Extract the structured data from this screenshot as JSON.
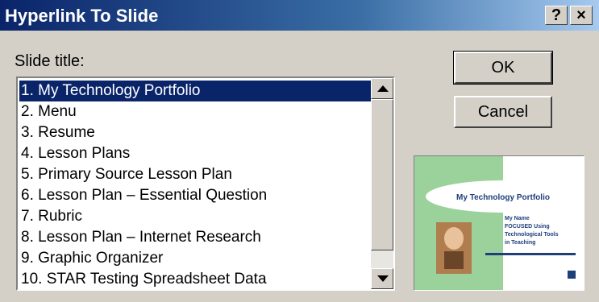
{
  "window": {
    "title": "Hyperlink To Slide",
    "help_label": "?",
    "close_label": "×"
  },
  "form": {
    "slide_title_label": "Slide title:"
  },
  "slides": [
    "1. My Technology Portfolio",
    "2. Menu",
    "3. Resume",
    "4. Lesson Plans",
    "5. Primary Source Lesson Plan",
    "6. Lesson Plan – Essential Question",
    "7. Rubric",
    "8. Lesson Plan – Internet Research",
    "9. Graphic Organizer",
    "10. STAR Testing Spreadsheet Data"
  ],
  "selected_index": 0,
  "buttons": {
    "ok": "OK",
    "cancel": "Cancel"
  },
  "preview": {
    "heading": "My Technology Portfolio",
    "body_lines": [
      "My Name",
      "FOCUSED Using",
      "Technological Tools",
      "in Teaching"
    ]
  },
  "colors": {
    "titlebar_start": "#0a246a",
    "titlebar_end": "#a6caf0",
    "selection": "#0a246a",
    "dialog_face": "#d4d0c8",
    "preview_green": "#9bd19b",
    "preview_text": "#1f3f7a"
  }
}
